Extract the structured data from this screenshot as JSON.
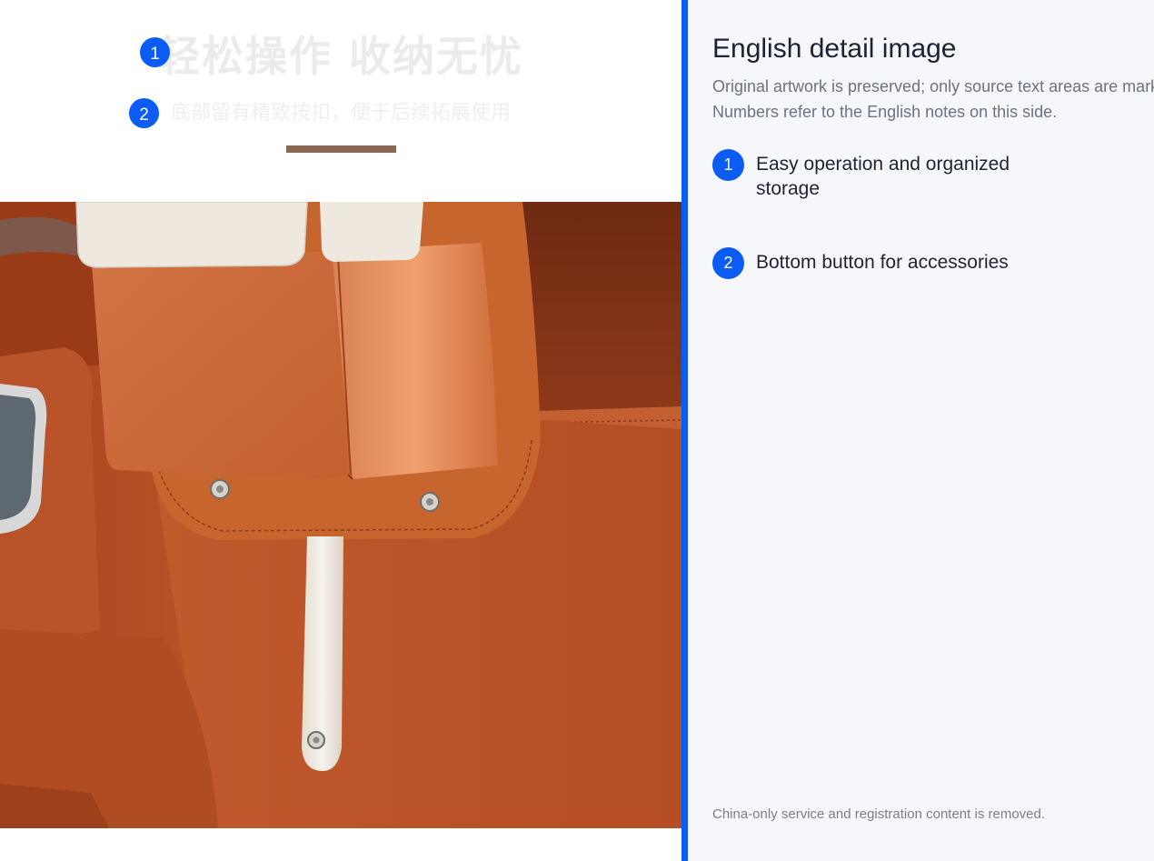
{
  "artwork": {
    "heading_cn": "轻松操作 收纳无忧",
    "subheading_cn": "底部留有精致按扣，便于后续拓展使用",
    "markers": [
      "1",
      "2"
    ]
  },
  "panel": {
    "title": "English detail image",
    "description_line1": "Original artwork is preserved; only source text areas are marked.",
    "description_line2": "Numbers refer to the English notes on this side.",
    "notes": [
      {
        "number": "1",
        "text": "Easy operation and organized storage"
      },
      {
        "number": "2",
        "text": "Bottom button for accessories"
      }
    ],
    "footer": "China-only service and registration content is removed."
  },
  "colors": {
    "accent": "#0a5cf5",
    "leather": "#c0582a",
    "cream": "#eee8df",
    "rule": "#8b6853"
  }
}
